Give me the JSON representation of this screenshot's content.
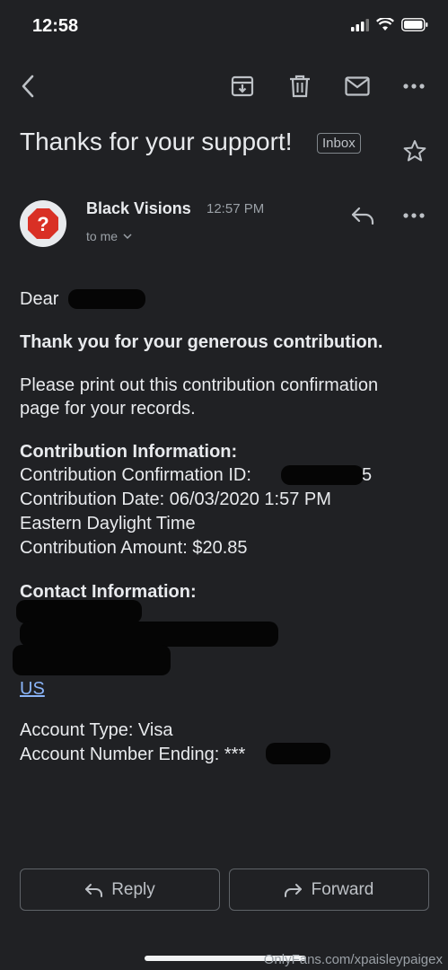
{
  "status_bar": {
    "time": "12:58"
  },
  "email": {
    "subject": "Thanks for your support!",
    "label": "Inbox",
    "sender": "Black Visions",
    "sent_time": "12:57 PM",
    "recipient": "to me",
    "avatar_glyph": "?"
  },
  "body": {
    "greeting": "Dear",
    "thanks": "Thank you for your generous contribution.",
    "print_line1": "Please print out this contribution confirmation",
    "print_line2": "page for your records.",
    "contribution_heading": "Contribution Information:",
    "confirmation_id": "Contribution Confirmation ID:",
    "confirmation_id_suffix": "5",
    "date_line1": "Contribution Date: 06/03/2020 1:57 PM",
    "date_line2": "Eastern Daylight Time",
    "amount": "Contribution Amount: $20.85",
    "contact_heading": "Contact Information:",
    "country_link": "US",
    "account_type": "Account Type: Visa",
    "account_number": "Account Number Ending: ***"
  },
  "actions": {
    "reply": "Reply",
    "forward": "Forward"
  },
  "watermark": "OnlyFans.com/xpaisleypaigex",
  "colors": {
    "background": "#202124",
    "text": "#e8eaed",
    "muted": "#9aa0a6",
    "link": "#8ab4f8",
    "avatar_icon": "#d93025"
  }
}
